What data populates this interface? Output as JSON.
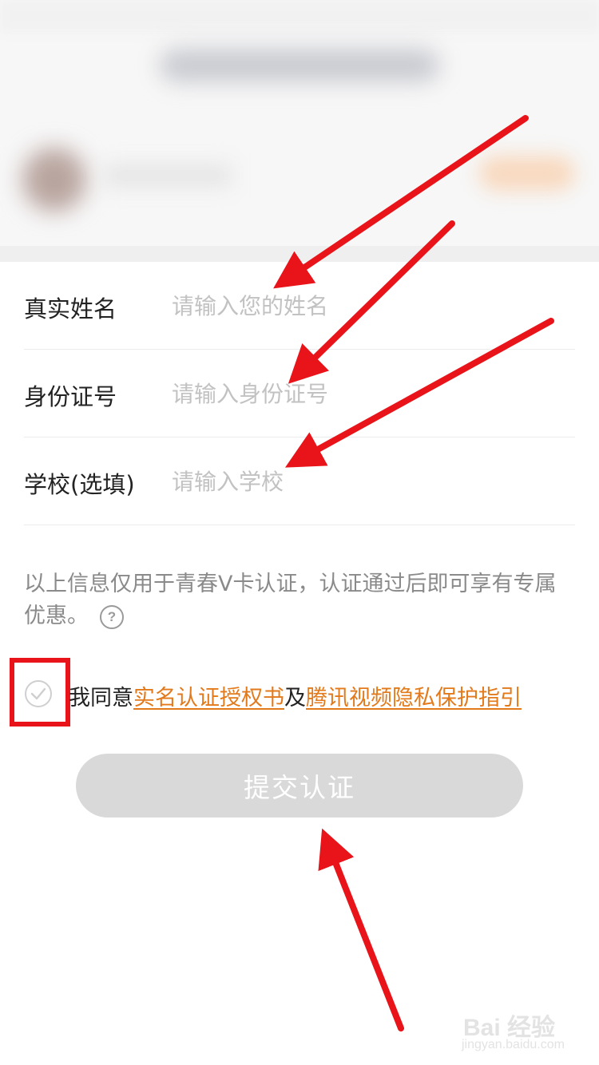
{
  "form": {
    "fields": [
      {
        "label": "真实姓名",
        "placeholder": "请输入您的姓名",
        "value": ""
      },
      {
        "label": "身份证号",
        "placeholder": "请输入身份证号",
        "value": ""
      },
      {
        "label": "学校(选填)",
        "placeholder": "请输入学校",
        "value": ""
      }
    ],
    "notice": "以上信息仅用于青春V卡认证，认证通过后即可享有专属优惠。",
    "help_icon_glyph": "?"
  },
  "agreement": {
    "prefix": "我同意",
    "link1": "实名认证授权书",
    "conjunction": "及",
    "link2": "腾讯视频隐私保护指引",
    "checked": false
  },
  "submit": {
    "label": "提交认证",
    "enabled": false
  },
  "watermark": {
    "brand": "Bai 经验",
    "url": "jingyan.baidu.com"
  },
  "colors": {
    "link": "#e27a1c",
    "highlight": "#e8141a",
    "button_disabled": "#d9d9d9",
    "placeholder": "#c2c2c2"
  },
  "icons": [
    "check-icon",
    "question-icon"
  ]
}
